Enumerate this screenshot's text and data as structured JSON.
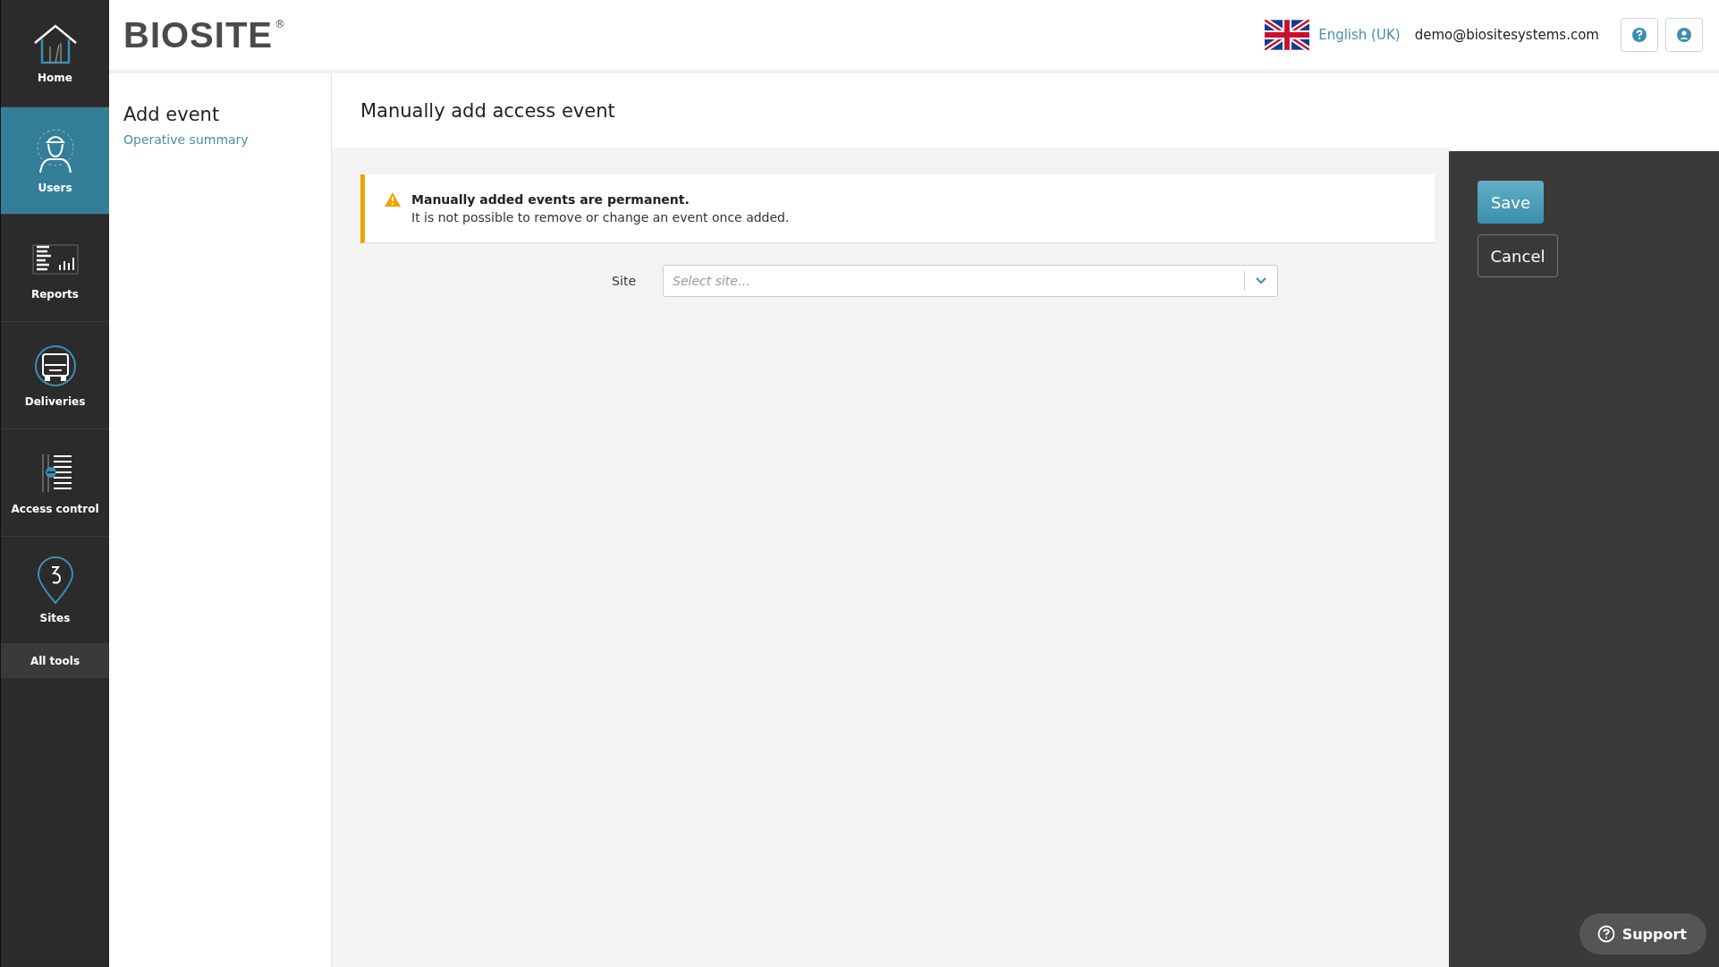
{
  "sidebar": {
    "items": [
      {
        "label": "Home",
        "selected": false
      },
      {
        "label": "Users",
        "selected": true
      },
      {
        "label": "Reports",
        "selected": false
      },
      {
        "label": "Deliveries",
        "selected": false
      },
      {
        "label": "Access control",
        "selected": false
      },
      {
        "label": "Sites",
        "selected": false
      }
    ],
    "all_tools": "All tools"
  },
  "header": {
    "logo": "BIOSITE",
    "logo_mark": "®",
    "language": "English (UK)",
    "email": "demo@biositesystems.com"
  },
  "left_pane": {
    "title": "Add event",
    "link": "Operative summary"
  },
  "content": {
    "title": "Manually add access event",
    "warning": {
      "title": "Manually added events are permanent.",
      "text": "It is not possible to remove or change an event once added."
    },
    "site_field": {
      "label": "Site",
      "placeholder": "Select site…"
    }
  },
  "actions": [
    "Save",
    "Cancel"
  ],
  "support": "Support"
}
